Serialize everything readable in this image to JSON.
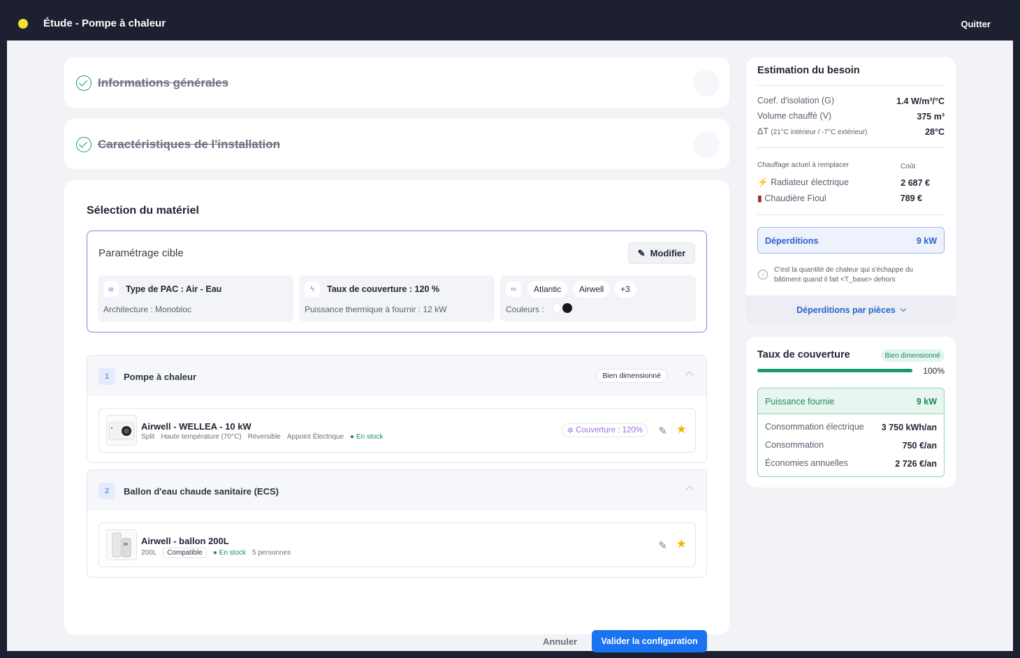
{
  "header": {
    "title": "Étude - Pompe à chaleur",
    "quit_label": "Quitter"
  },
  "steps": [
    {
      "label": "Informations générales"
    },
    {
      "label": "Caractéristiques de l'installation"
    }
  ],
  "selection": {
    "title": "Sélection du matériel",
    "param": {
      "title": "Paramétrage cible",
      "modify_label": "Modifier",
      "tiles": [
        {
          "label": "Type de PAC : Air - Eau",
          "sub": "Architecture : Monobloc"
        },
        {
          "label": "Taux de couverture : 120 %",
          "sub": "Puissance thermique à fournir : 12 kW"
        }
      ],
      "brands": [
        "Atlantic",
        "Airwell",
        "+3"
      ],
      "colors_label": "Couleurs :"
    },
    "groups": [
      {
        "num": "1",
        "title": "Pompe à chaleur",
        "badge": "Bien dimensionné",
        "product": {
          "name": "Airwell - WELLEA - 10 kW",
          "tags": [
            "Split",
            "Haute température (70°C)",
            "Réversible",
            "Appoint Électrique"
          ],
          "stock": "En stock",
          "coverage": "Couverture : 120%"
        }
      },
      {
        "num": "2",
        "title": "Ballon d'eau chaude sanitaire (ECS)",
        "product": {
          "name": "Airwell - ballon 200L",
          "size": "200L",
          "compat": "Compatible",
          "stock": "En stock",
          "persons": "5 personnes"
        }
      }
    ],
    "cancel_label": "Annuler",
    "validate_label": "Valider la configuration"
  },
  "estimation": {
    "title": "Estimation du besoin",
    "rows": [
      {
        "label": "Coef. d'isolation (G)",
        "value": "1.4 W/m³/°C"
      },
      {
        "label": "Volume chauffé (V)",
        "value": "375 m³"
      },
      {
        "label": "ΔT",
        "label_small": "(21°C intérieur / -7°C extérieur)",
        "value": "28°C"
      }
    ],
    "heating_header": "Chauffage actuel à remplacer",
    "cost_header": "Coût",
    "heating": [
      {
        "label": "Radiateur électrique",
        "value": "2 687 €"
      },
      {
        "label": "Chaudière Fioul",
        "value": "789 €"
      }
    ],
    "deperditions_label": "Déperditions",
    "deperditions_value": "9 kW",
    "info_text": "C'est la quantité de chaleur qui s'échappe du bâtiment quand il fait <T_base> dehors",
    "rooms_label": "Déperditions par pièces"
  },
  "coverage": {
    "title": "Taux de couverture",
    "badge": "Bien dimensionné",
    "percent_label": "100%",
    "percent": 100,
    "power_label": "Puissance fournie",
    "power_value": "9 kW",
    "rows": [
      {
        "label": "Consommation électrique",
        "value": "3 750 kWh/an"
      },
      {
        "label": "Consommation",
        "value": "750 €/an"
      },
      {
        "label": "Économies annuelles",
        "value": "2 726 €/an"
      }
    ]
  },
  "colors": {
    "accent": "#1a73f0",
    "success": "#1a9a6a",
    "purple": "#8b7de0",
    "star": "#f5b400"
  }
}
